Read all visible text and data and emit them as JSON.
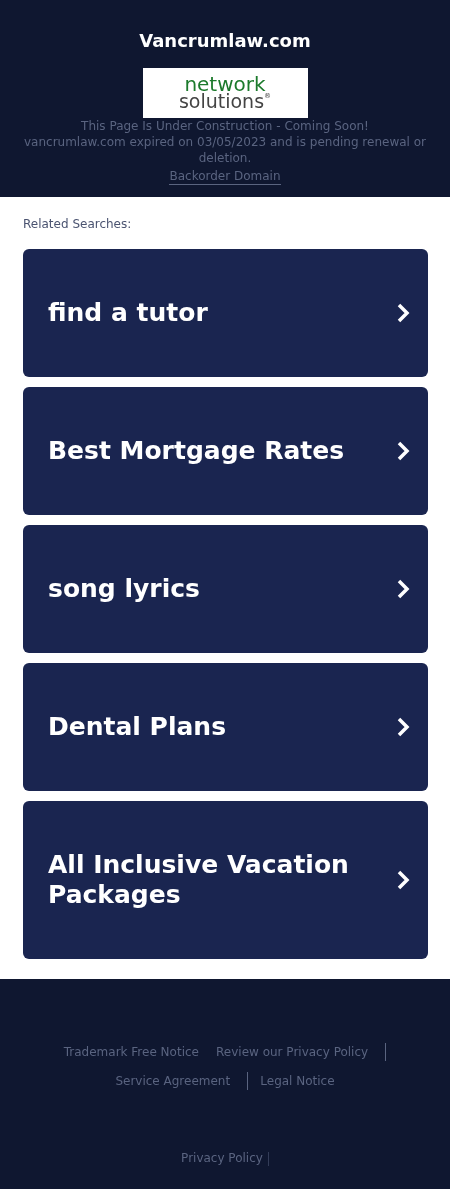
{
  "header": {
    "title": "Vancrumlaw.com",
    "logo": {
      "line_1": "network",
      "line_2": "solutions",
      "mark": "®"
    },
    "notice": "This Page Is Under Construction - Coming Soon!",
    "expiry": "vancrumlaw.com expired on 03/05/2023 and is pending renewal or deletion.",
    "link": "Backorder Domain"
  },
  "related": {
    "heading": "Related Searches:",
    "items": [
      {
        "label": "find a tutor"
      },
      {
        "label": "Best Mortgage Rates"
      },
      {
        "label": "song lyrics"
      },
      {
        "label": "Dental Plans"
      },
      {
        "label": "All Inclusive Vacation Packages"
      }
    ]
  },
  "footer": {
    "links": [
      "Trademark Free Notice",
      "Review our Privacy Policy",
      "Service Agreement",
      "Legal Notice"
    ],
    "bottom_link": "Privacy Policy"
  }
}
